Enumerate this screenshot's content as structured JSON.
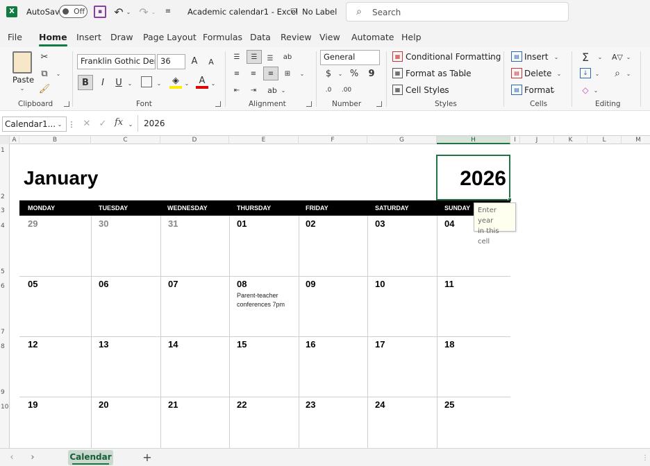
{
  "titlebar": {
    "autosave_label": "AutoSave",
    "autosave_state": "Off",
    "filename": "Academic calendar1",
    "separator": "-",
    "app": "Excel",
    "sensitivity": "No Label",
    "search_placeholder": "Search"
  },
  "menu": [
    "File",
    "Home",
    "Insert",
    "Draw",
    "Page Layout",
    "Formulas",
    "Data",
    "Review",
    "View",
    "Automate",
    "Help"
  ],
  "menu_active": "Home",
  "ribbon": {
    "clipboard": {
      "paste": "Paste",
      "label": "Clipboard"
    },
    "font": {
      "name": "Franklin Gothic Dem",
      "size": "36",
      "label": "Font",
      "bold": "B",
      "italic": "I",
      "underline": "U"
    },
    "alignment": {
      "label": "Alignment"
    },
    "number": {
      "format": "General",
      "label": "Number",
      "currency": "$",
      "percent": "%",
      "comma": "9"
    },
    "styles": {
      "conditional": "Conditional Formatting",
      "table": "Format as Table",
      "cell_styles": "Cell Styles",
      "label": "Styles"
    },
    "cells": {
      "insert": "Insert",
      "delete": "Delete",
      "format": "Format",
      "label": "Cells"
    },
    "editing": {
      "label": "Editing"
    }
  },
  "formula_bar": {
    "name_box": "Calendar1...",
    "fx": "fx",
    "value": "2026"
  },
  "columns": [
    "A",
    "B",
    "C",
    "D",
    "E",
    "F",
    "G",
    "H",
    "I",
    "J",
    "K",
    "L",
    "M"
  ],
  "selected_column": "H",
  "rows": [
    "1",
    "2",
    "3",
    "4",
    "5",
    "6",
    "7",
    "8",
    "9",
    "10"
  ],
  "calendar": {
    "month": "January",
    "year": "2026",
    "weekdays": [
      "MONDAY",
      "TUESDAY",
      "WEDNESDAY",
      "THURSDAY",
      "FRIDAY",
      "SATURDAY",
      "SUNDAY"
    ],
    "weeks": [
      [
        "29",
        "30",
        "31",
        "01",
        "02",
        "03",
        "04"
      ],
      [
        "05",
        "06",
        "07",
        "08",
        "09",
        "10",
        "11"
      ],
      [
        "12",
        "13",
        "14",
        "15",
        "16",
        "17",
        "18"
      ],
      [
        "19",
        "20",
        "21",
        "22",
        "23",
        "24",
        "25"
      ]
    ],
    "prev_month_days": 3,
    "event": {
      "line1": "Parent-teacher",
      "line2": "conferences 7pm"
    },
    "tooltip": {
      "line1": "Enter year",
      "line2": "in this cell"
    }
  },
  "sheet_tab": "Calendar",
  "colors": {
    "accent": "#217346",
    "header_bg": "#000000"
  }
}
